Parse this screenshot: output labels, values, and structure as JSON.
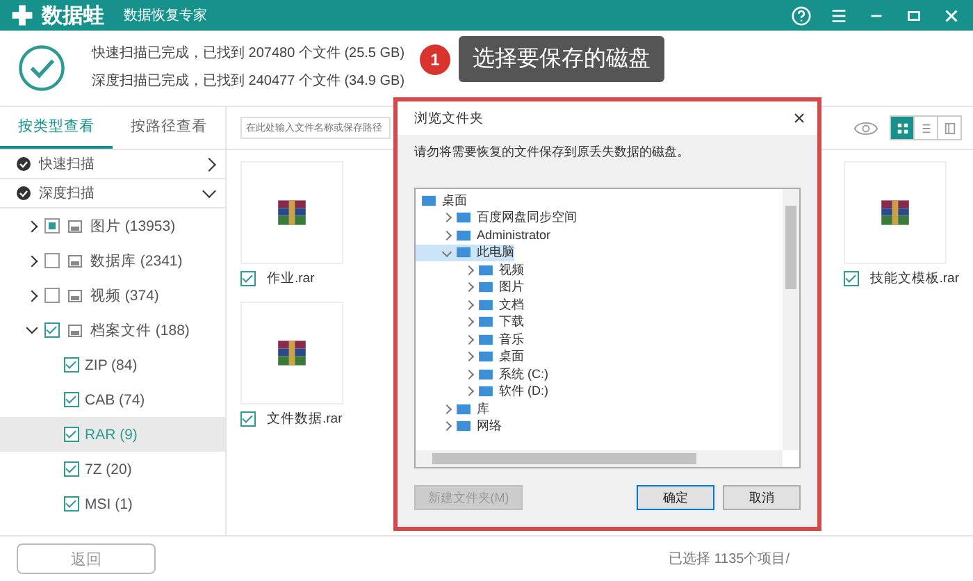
{
  "app": {
    "logo": "数据蛙",
    "subtitle": "数据恢复专家"
  },
  "scan_summary": [
    "快速扫描已完成，已找到 207480 个文件 (25.5 GB)",
    "深度扫描已完成，已找到 240477 个文件 (34.9 GB)"
  ],
  "callout": {
    "number": "1",
    "text": "选择要保存的磁盘"
  },
  "tabs": [
    {
      "label": "按类型查看",
      "selected": true
    },
    {
      "label": "按路径查看",
      "selected": false
    }
  ],
  "search": {
    "placeholder": "在此处输入文件名称或保存路径"
  },
  "view_modes": [
    {
      "kind": "grid",
      "selected": true
    },
    {
      "kind": "list",
      "selected": false
    },
    {
      "kind": "detail",
      "selected": false
    }
  ],
  "scans": [
    {
      "label": "快速扫描",
      "expanded": false
    },
    {
      "label": "深度扫描",
      "expanded": true
    }
  ],
  "categories": [
    {
      "label": "图片 (13953)",
      "expanded": false,
      "checked": false,
      "partial": true
    },
    {
      "label": "数据库 (2341)",
      "expanded": false,
      "checked": false,
      "partial": false
    },
    {
      "label": "视频 (374)",
      "expanded": false,
      "checked": false,
      "partial": false
    },
    {
      "label": "档案文件 (188)",
      "expanded": true,
      "checked": true,
      "partial": false,
      "children": [
        {
          "label": "ZIP (84)",
          "checked": true,
          "selected": false
        },
        {
          "label": "CAB (74)",
          "checked": true,
          "selected": false
        },
        {
          "label": "RAR (9)",
          "checked": true,
          "selected": true
        },
        {
          "label": "7Z (20)",
          "checked": true,
          "selected": false
        },
        {
          "label": "MSI (1)",
          "checked": true,
          "selected": false
        }
      ]
    }
  ],
  "file_columns": [
    [
      {
        "name": "作业.rar",
        "checked": true
      },
      {
        "name": "文件数据.rar",
        "checked": true
      }
    ],
    [
      {
        "name": "技能文模板.rar",
        "checked": true
      }
    ]
  ],
  "dialog": {
    "title": "浏览文件夹",
    "message": "请勿将需要恢复的文件保存到原丢失数据的磁盘。",
    "tree": [
      {
        "label": "桌面",
        "selected": false,
        "children": [
          {
            "label": "百度网盘同步空间",
            "expanded": false,
            "selected": false
          },
          {
            "label": "Administrator",
            "expanded": false,
            "selected": false
          },
          {
            "label": "此电脑",
            "expanded": true,
            "selected": true,
            "children": [
              {
                "label": "视频",
                "expanded": false,
                "selected": false
              },
              {
                "label": "图片",
                "expanded": false,
                "selected": false
              },
              {
                "label": "文档",
                "expanded": false,
                "selected": false
              },
              {
                "label": "下载",
                "expanded": false,
                "selected": false
              },
              {
                "label": "音乐",
                "expanded": false,
                "selected": false
              },
              {
                "label": "桌面",
                "expanded": false,
                "selected": false
              },
              {
                "label": "系统 (C:)",
                "expanded": false,
                "selected": false
              },
              {
                "label": "软件 (D:)",
                "expanded": false,
                "selected": false
              }
            ]
          },
          {
            "label": "库",
            "expanded": false,
            "selected": false
          },
          {
            "label": "网络",
            "expanded": false,
            "selected": false
          }
        ]
      }
    ],
    "buttons": [
      {
        "label": "新建文件夹(M)",
        "disabled": true,
        "kind": "new"
      },
      {
        "label": "确定",
        "disabled": false,
        "kind": "ok"
      },
      {
        "label": "取消",
        "disabled": false,
        "kind": "cancel"
      }
    ]
  },
  "back_button": "返回",
  "status": "已选择 1135个项目/"
}
